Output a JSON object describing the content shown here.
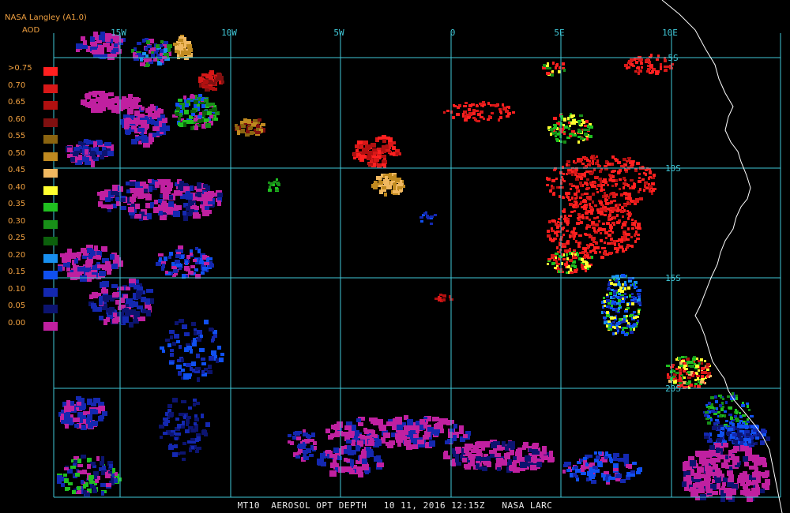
{
  "header": {
    "org": "NASA Langley (A1.0)",
    "product": "AOD"
  },
  "legend": {
    "items": [
      {
        "label": ">0.75",
        "color": "#ff2020"
      },
      {
        "label": "0.70",
        "color": "#d81818"
      },
      {
        "label": "0.65",
        "color": "#b01010"
      },
      {
        "label": "0.60",
        "color": "#801010"
      },
      {
        "label": "0.55",
        "color": "#8a6410"
      },
      {
        "label": "0.50",
        "color": "#c08a20"
      },
      {
        "label": "0.45",
        "color": "#f0b860"
      },
      {
        "label": "0.40",
        "color": "#ffff30"
      },
      {
        "label": "0.35",
        "color": "#20c020"
      },
      {
        "label": "0.30",
        "color": "#189018"
      },
      {
        "label": "0.25",
        "color": "#0c600c"
      },
      {
        "label": "0.20",
        "color": "#1890f0"
      },
      {
        "label": "0.15",
        "color": "#1050f0"
      },
      {
        "label": "0.10",
        "color": "#1428b0"
      },
      {
        "label": "0.05",
        "color": "#0c1470"
      },
      {
        "label": "0.00",
        "color": "#c020a0"
      }
    ]
  },
  "map": {
    "grid_color": "#40c8d8",
    "coast_color": "#ffffff",
    "lon_labels": [
      "15W",
      "10W",
      "5W",
      "0",
      "5E",
      "10E"
    ],
    "lat_labels": [
      "5S",
      "10S",
      "15S",
      "20S"
    ],
    "lon_range": [
      -20,
      14
    ],
    "lat_range": [
      -2,
      -23
    ]
  },
  "footer": {
    "text": "MT10  AEROSOL OPT DEPTH   10 11, 2016 12:15Z   NASA LARC"
  }
}
